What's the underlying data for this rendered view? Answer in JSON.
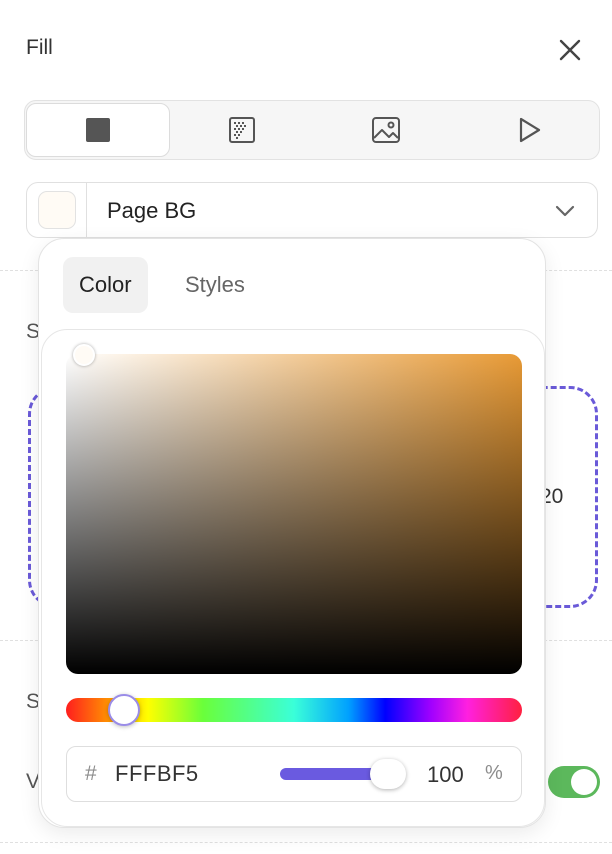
{
  "panel": {
    "title": "Fill",
    "close_icon": "close-icon"
  },
  "fill_types": [
    {
      "name": "solid",
      "icon": "solid-square-icon",
      "active": true
    },
    {
      "name": "gradient",
      "icon": "gradient-icon",
      "active": false
    },
    {
      "name": "image",
      "icon": "image-icon",
      "active": false
    },
    {
      "name": "video",
      "icon": "play-icon",
      "active": false
    }
  ],
  "color_select": {
    "swatch_color": "#FFFBF5",
    "name": "Page BG",
    "chevron_icon": "chevron-down-icon"
  },
  "background": {
    "label_s1": "S",
    "label_s2": "S",
    "label_v": "V",
    "number_fragment": "20",
    "accent_color": "#6a5ad8",
    "toggle_color": "#5cb85c",
    "toggle_on": true
  },
  "popover": {
    "tabs": [
      {
        "label": "Color",
        "active": true
      },
      {
        "label": "Styles",
        "active": false
      }
    ],
    "hue_color": "#e89a35",
    "hex_prefix": "#",
    "hex_value": "FFFBF5",
    "opacity": "100",
    "opacity_unit": "%",
    "slider_color": "#6a5ae0"
  }
}
